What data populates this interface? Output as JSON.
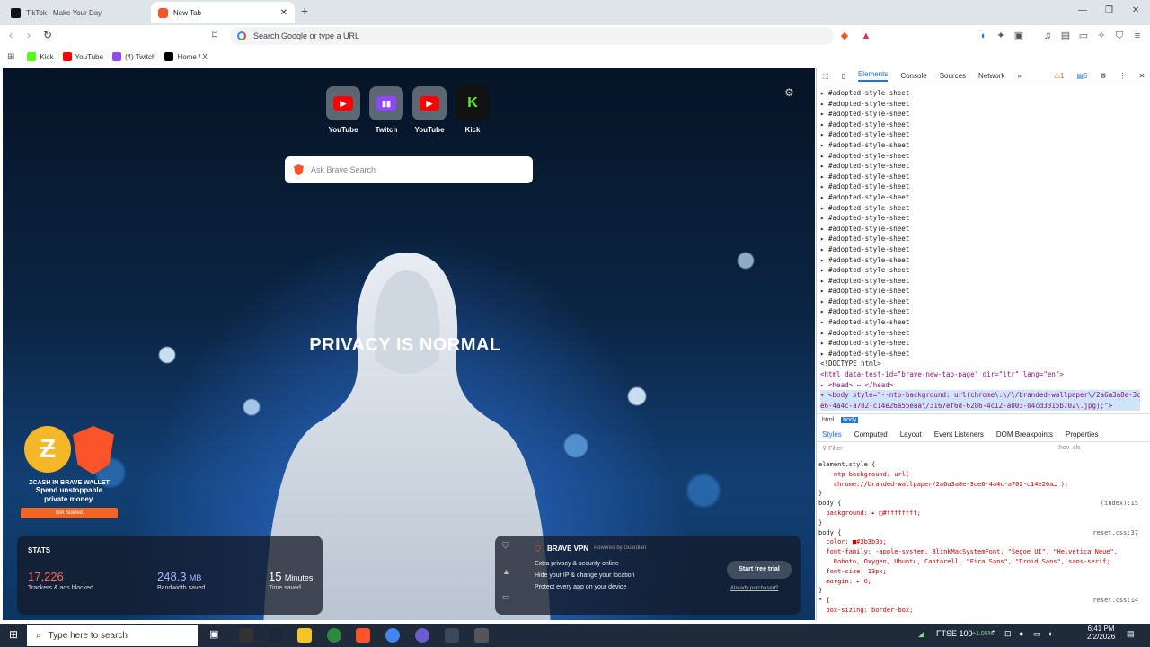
{
  "tabs": [
    {
      "title": "TikTok - Make Your Day",
      "color": "#111111"
    },
    {
      "title": "New Tab",
      "color": "#fb542b"
    }
  ],
  "omnibox": {
    "placeholder": "Search Google or type a URL"
  },
  "bookmarks": [
    {
      "label": "Kick",
      "color": "#53fc18"
    },
    {
      "label": "YouTube",
      "color": "#ff0000"
    },
    {
      "label": "(4) Twitch",
      "color": "#9146ff"
    },
    {
      "label": "Home / X",
      "color": "#000000"
    }
  ],
  "tiles": [
    {
      "label": "YouTube",
      "color": "#ff0000",
      "glyph": "▶"
    },
    {
      "label": "Twitch",
      "color": "#9146ff",
      "glyph": "▮▮"
    },
    {
      "label": "YouTube",
      "color": "#ff0000",
      "glyph": "▶"
    },
    {
      "label": "Kick",
      "color": "#111111",
      "glyph": "K"
    }
  ],
  "search": {
    "placeholder": "Ask Brave Search"
  },
  "headline": "PRIVACY IS NORMAL",
  "promo": {
    "line1": "ZCASH IN BRAVE WALLET",
    "line2": "Spend unstoppable",
    "line3": "private money.",
    "button": "Get Started"
  },
  "stats": {
    "label": "STATS",
    "trackers": {
      "value": "17,226",
      "desc": "Trackers & ads blocked",
      "color": "#ff6b57"
    },
    "bandwidth": {
      "value": "248.3",
      "unit": "MB",
      "desc": "Bandwidth saved",
      "color": "#9fb8ff"
    },
    "time": {
      "value": "15",
      "unit": "Minutes",
      "desc": "Time saved"
    }
  },
  "vpn": {
    "title": "BRAVE VPN",
    "powered_by": "Powered by Guardian",
    "features": [
      "Extra privacy & security online",
      "Hide your IP & change your location",
      "Protect every app on your device"
    ],
    "trial": "Start free trial",
    "already": "Already purchased?"
  },
  "devtools": {
    "tabs": [
      "Elements",
      "Console",
      "Sources",
      "Network"
    ],
    "warnings": "1",
    "infos": "5",
    "adopted": "#adopted-style-sheet",
    "adopted_count": 26,
    "doctype": "<!DOCTYPE html>",
    "html_line": "<html data-test-id=\"brave-new-tab-page\" dir=\"ltr\" lang=\"en\">",
    "head_line": "▸ <head> ⋯ </head>",
    "body_line1": "▾ <body style=\"--ntp-background: url(chrome\\:\\/\\/branded-wallpaper\\/2a6a3a8e-3c",
    "body_line2": "e6-4a4c-a702-c14e26a55eaa\\/3167ef6d-6286-4c12-a003-04cd3315b702\\.jpg);\">",
    "crumbs": [
      "html",
      "body"
    ],
    "subtabs": [
      "Styles",
      "Computed",
      "Layout",
      "Event Listeners",
      "DOM Breakpoints",
      "Properties"
    ],
    "filter": "Filter",
    "hov": ":hov .cls",
    "styles": [
      {
        "text": "element.style {",
        "src": ""
      },
      {
        "text": "  --ntp-background: url(",
        "src": ""
      },
      {
        "text": "    chrome://branded-wallpaper/2a6a3a8e-3ce6-4a4c-a702-c14e26a… );",
        "src": ""
      },
      {
        "text": "}",
        "src": ""
      },
      {
        "text": "body {",
        "src": "(index):15"
      },
      {
        "text": "  background: ▸ □#ffffffff;",
        "src": ""
      },
      {
        "text": "}",
        "src": ""
      },
      {
        "text": "body {",
        "src": "reset.css:37"
      },
      {
        "text": "  color: ■#3b3b3b;",
        "src": ""
      },
      {
        "text": "  font-family: -apple-system, BlinkMacSystemFont, \"Segoe UI\", \"Helvetica Neue\",",
        "src": ""
      },
      {
        "text": "    Roboto, Oxygen, Ubuntu, Cantarell, \"Fira Sans\", \"Droid Sans\", sans-serif;",
        "src": ""
      },
      {
        "text": "  font-size: 13px;",
        "src": ""
      },
      {
        "text": "  margin: ▸ 0;",
        "src": ""
      },
      {
        "text": "}",
        "src": ""
      },
      {
        "text": "* {",
        "src": "reset.css:14"
      },
      {
        "text": "  box-sizing: border-box;",
        "src": ""
      }
    ]
  },
  "taskbar": {
    "search_placeholder": "Type here to search",
    "ftse": "FTSE 100",
    "ftse_change": "+1.05%",
    "time": "6:41 PM",
    "date": "2/2/2026"
  }
}
